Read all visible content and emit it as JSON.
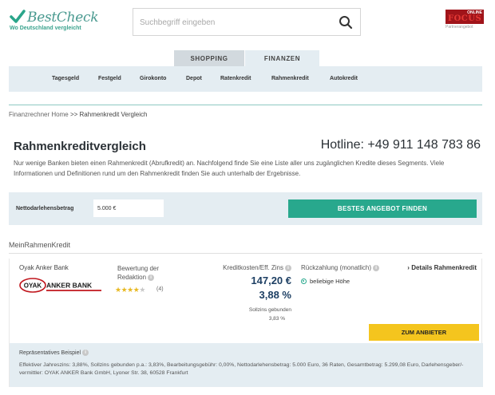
{
  "brand": {
    "name": "BestCheck",
    "tagline": "Wo Deutschland vergleicht"
  },
  "search": {
    "placeholder": "Suchbegriff eingeben"
  },
  "partner": {
    "online": "ONLINE",
    "word": "FOCUS",
    "sub": "Partnerangebot"
  },
  "tabs": [
    {
      "label": "SHOPPING",
      "active": false
    },
    {
      "label": "FINANZEN",
      "active": true
    }
  ],
  "nav": [
    "Tagesgeld",
    "Festgeld",
    "Girokonto",
    "Depot",
    "Ratenkredit",
    "Rahmenkredit",
    "Autokredit"
  ],
  "breadcrumb": {
    "parent": "Finanzrechner Home",
    "separator": ">>",
    "current": "Rahmenkredit Vergleich"
  },
  "page": {
    "title": "Rahmenkreditvergleich",
    "hotline": "Hotline: +49 911 148 783 86",
    "intro": "Nur wenige Banken bieten einen Rahmenkredit (Abrufkredit) an. Nachfolgend finde Sie eine Liste aller uns zugänglichen Kredite dieses Segments. Viele Informationen und Definitionen rund um den Rahmenkredit finden Sie auch unterhalb der Ergebnisse."
  },
  "calculator": {
    "amount_label": "Nettodarlehensbetrag",
    "amount_value": "5.000 €",
    "submit_label": "BESTES ANGEBOT FINDEN"
  },
  "results": {
    "heading": "MeinRahmenKredit",
    "offers": [
      {
        "bank": "Oyak Anker Bank",
        "logo_text_left": "OYAK",
        "logo_text_right": "ANKER BANK",
        "rating_label": "Bewertung der Redaktion",
        "rating": 4,
        "rating_max": 5,
        "rating_count": "(4)",
        "cost_label": "Kreditkosten/Eff. Zins",
        "cost": "147,20 €",
        "rate": "3,88 %",
        "fixed_label": "Sollzins gebunden",
        "fixed_rate": "3,83 %",
        "repay_label": "Rückzahlung (monatlich)",
        "repay_option": "beliebige Höhe",
        "details_label": "Details Rahmenkredit",
        "provider_label": "ZUM ANBIETER",
        "rep_heading": "Repräsentatives Beispiel",
        "rep_text": "Effektiver Jahreszins: 3,88%, Sollzins gebunden p.a.: 3,83%, Bearbeitungsgebühr: 0,00%, Nettodarlehensbetrag: 5.000 Euro, 36 Raten, Gesamtbetrag: 5.299,08 Euro, Darlehensgeber/-vermittler: OYAK ANKER Bank GmbH, Lyoner Str. 38, 60528 Frankfurt"
      }
    ]
  },
  "colors": {
    "accent_green": "#28a88d",
    "nav_bg": "#e4edf2",
    "cta_yellow": "#f4c51e",
    "value_blue": "#1d3f63",
    "star": "#e8b923"
  }
}
